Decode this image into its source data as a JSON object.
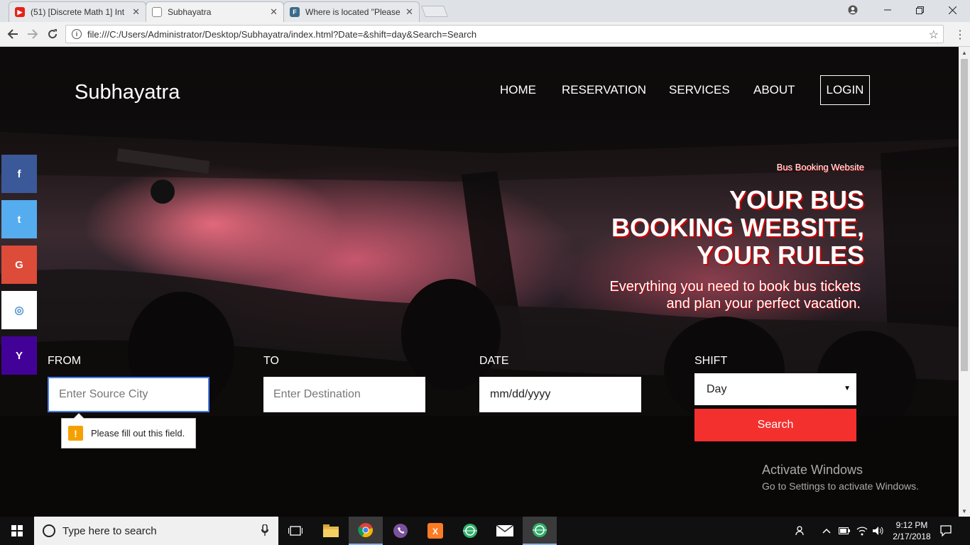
{
  "browser": {
    "tabs": [
      {
        "title": "(51) [Discrete Math 1] Int",
        "favicon": "youtube-icon",
        "favicon_color": "#e62117"
      },
      {
        "title": "Subhayatra",
        "favicon": "page-icon",
        "active": true
      },
      {
        "title": "Where is located \"Please",
        "favicon": "F",
        "favicon_color": "#3b6b8a"
      }
    ],
    "close_glyph": "✕",
    "url": "file:///C:/Users/Administrator/Desktop/Subhayatra/index.html?Date=&shift=day&Search=Search"
  },
  "site": {
    "brand": "Subhayatra",
    "nav": {
      "home": "HOME",
      "reservation": "RESERVATION",
      "services": "SERVICES",
      "about": "ABOUT",
      "login": "LOGIN"
    },
    "social": {
      "facebook": "f",
      "twitter": "t",
      "google": "G",
      "instagram": "◎",
      "yahoo": "Y"
    },
    "social_colors": {
      "facebook": "#3b5998",
      "twitter": "#55acee",
      "google": "#dd4b39",
      "instagram": "#ffffff",
      "yahoo": "#430297"
    },
    "hero": {
      "tag": "Bus Booking Website",
      "title_line1": "YOUR BUS",
      "title_line2": "BOOKING WEBSITE,",
      "title_line3": "YOUR RULES",
      "sub_line1": "Everything you need to book bus tickets",
      "sub_line2": "and plan your perfect vacation."
    },
    "form": {
      "from_label": "FROM",
      "from_placeholder": "Enter Source City",
      "to_label": "TO",
      "to_placeholder": "Enter Destination",
      "date_label": "DATE",
      "date_value": "mm/dd/yyyy",
      "shift_label": "SHIFT",
      "shift_value": "Day",
      "search_label": "Search",
      "validation_message": "Please fill out this field."
    },
    "accent_color": "#f3302e"
  },
  "watermark": {
    "line1": "Activate Windows",
    "line2": "Go to Settings to activate Windows."
  },
  "taskbar": {
    "search_placeholder": "Type here to search",
    "time": "9:12 PM",
    "date": "2/17/2018"
  }
}
